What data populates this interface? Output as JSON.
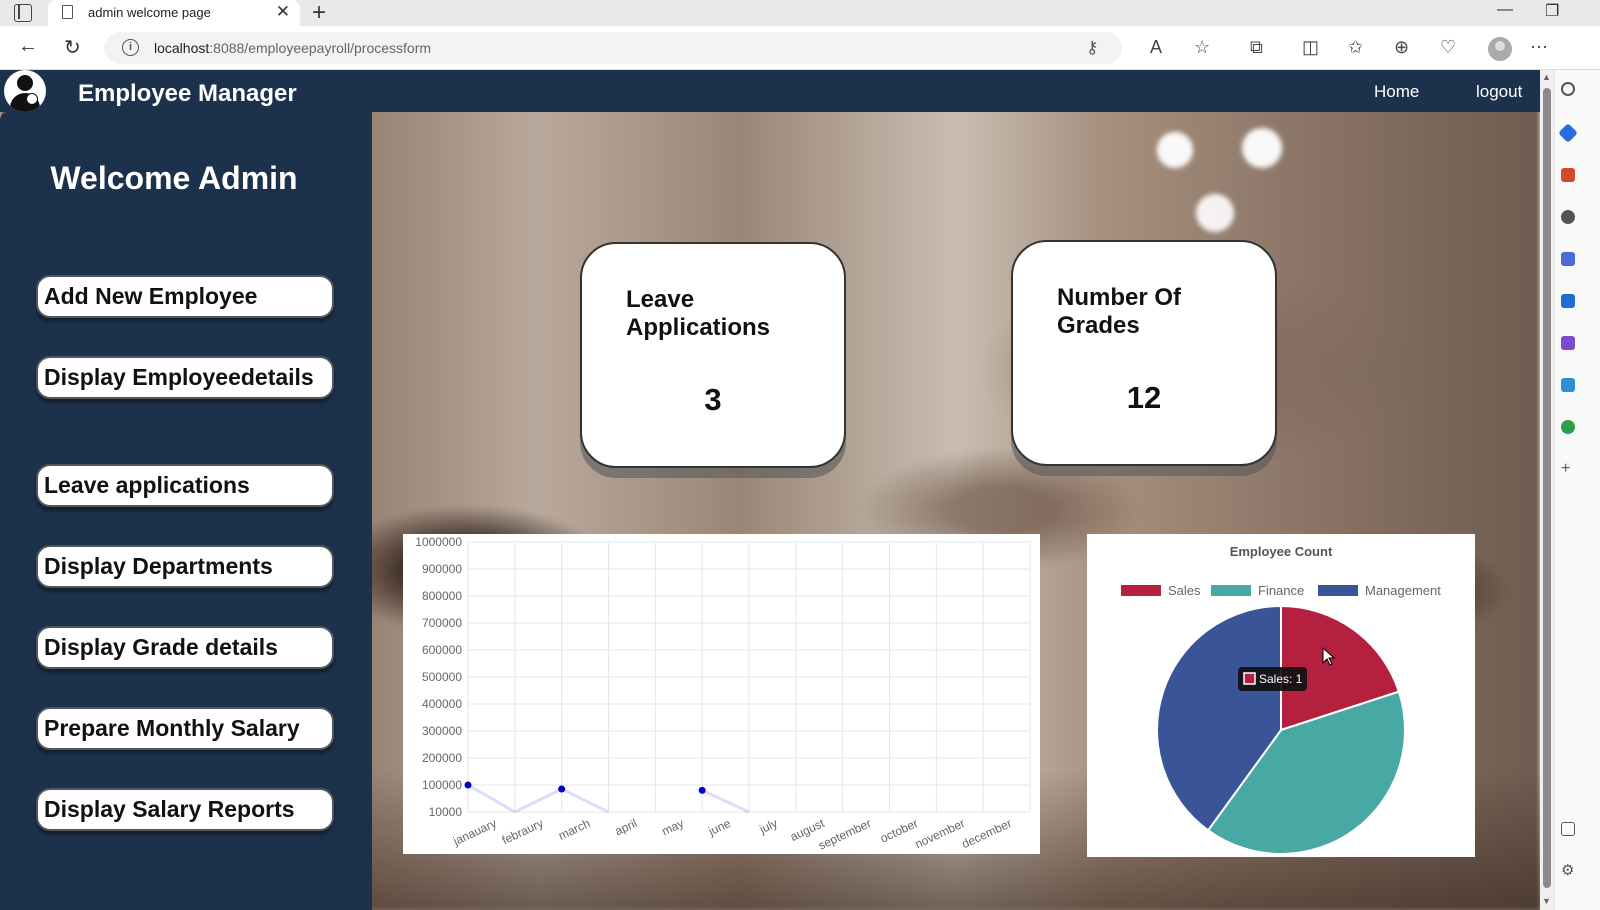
{
  "browser": {
    "tab_title": "admin welcome page",
    "url_host": "localhost",
    "url_rest": ":8088/employeepayroll/processform"
  },
  "app": {
    "brand": "Employee Manager",
    "nav": {
      "home": "Home",
      "logout": "logout"
    },
    "welcome": "Welcome Admin",
    "sidebar_buttons": [
      "Add New Employee",
      "Display Employeedetails",
      "Leave applications",
      "Display Departments",
      "Display Grade details",
      "Prepare Monthly Salary",
      "Display Salary Reports"
    ],
    "cards": [
      {
        "title": "Leave Applications",
        "value": "3"
      },
      {
        "title": "Number Of Grades",
        "value": "12"
      }
    ]
  },
  "chart_data": [
    {
      "type": "line",
      "x": [
        "janauary",
        "febraury",
        "march",
        "april",
        "may",
        "june",
        "july",
        "august",
        "september",
        "october",
        "november",
        "december"
      ],
      "y_ticks": [
        "1000000",
        "900000",
        "800000",
        "700000",
        "600000",
        "500000",
        "400000",
        "300000",
        "200000",
        "100000",
        "10000"
      ],
      "series": [
        {
          "values": [
            100000,
            0,
            85000,
            0,
            null,
            80000,
            0,
            null,
            null,
            null,
            null,
            null
          ],
          "color": "#0000cc"
        }
      ],
      "ylim": [
        0,
        1000000
      ],
      "grid": true,
      "title": "",
      "xlabel": "",
      "ylabel": ""
    },
    {
      "type": "pie",
      "title": "Employee Count",
      "legend_position": "top",
      "labels": [
        "Sales",
        "Finance",
        "Management"
      ],
      "values": [
        1,
        2,
        2
      ],
      "colors": [
        "#b5203f",
        "#48a8a4",
        "#3a5597"
      ],
      "tooltip": "Sales: 1"
    }
  ]
}
